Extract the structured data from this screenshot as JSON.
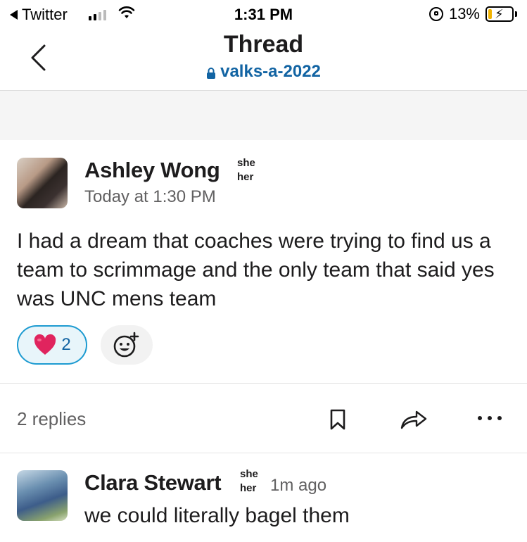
{
  "status_bar": {
    "back_app": "Twitter",
    "time": "1:31 PM",
    "battery_percent": "13%",
    "battery_level": 0.13,
    "signal_bars": 2
  },
  "header": {
    "title": "Thread",
    "channel": "valks-a-2022"
  },
  "parent_message": {
    "author": "Ashley Wong",
    "pronoun_top": "she",
    "pronoun_bottom": "her",
    "timestamp": "Today at 1:30 PM",
    "text": "I had a dream that coaches were trying to find us a team to scrimmage and the only team that said yes was UNC mens team",
    "reactions": [
      {
        "emoji": "heart-icon",
        "count": "2",
        "selected": true
      }
    ]
  },
  "thread_actions": {
    "replies_label": "2 replies"
  },
  "replies": [
    {
      "author": "Clara Stewart",
      "pronoun_top": "she",
      "pronoun_bottom": "her",
      "timestamp": "1m ago",
      "text": "we could literally bagel them"
    }
  ],
  "colors": {
    "link_blue": "#1264a3",
    "reaction_border": "#1d9bd1",
    "reaction_bg": "#e8f5fa",
    "heart_red": "#e0245e",
    "battery_yellow": "#f1b300"
  }
}
